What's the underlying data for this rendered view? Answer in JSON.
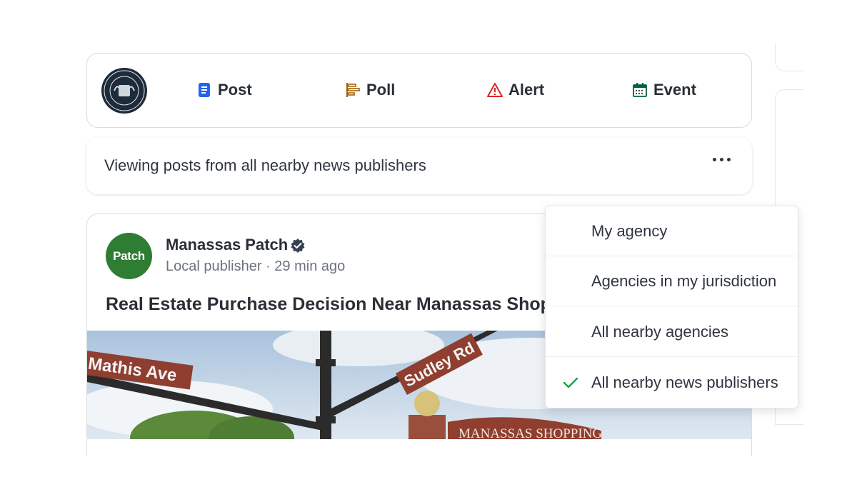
{
  "composer": {
    "agency_seal_icon": "county-seal-icon",
    "actions": [
      {
        "label": "Post",
        "icon": "post-icon",
        "color": "#2563eb"
      },
      {
        "label": "Poll",
        "icon": "poll-icon",
        "color": "#a16207"
      },
      {
        "label": "Alert",
        "icon": "alert-icon",
        "color": "#dc2626"
      },
      {
        "label": "Event",
        "icon": "calendar-icon",
        "color": "#065f46"
      }
    ]
  },
  "filter": {
    "text": "Viewing posts from all nearby news publishers",
    "more_icon": "more-horizontal-icon"
  },
  "post": {
    "avatar_text": "Patch",
    "avatar_color": "#2e7d32",
    "publisher": "Manassas Patch",
    "verified_icon": "verified-badge-icon",
    "meta": "Local publisher · 29 min ago",
    "title": "Real Estate Purchase Decision Near Manassas Shopping",
    "image": {
      "signs": [
        "Mathis Ave",
        "Sudley Rd",
        "MANASSAS SHOPPING"
      ]
    }
  },
  "menu": {
    "items": [
      {
        "label": "My agency",
        "selected": false
      },
      {
        "label": "Agencies in my jurisdiction",
        "selected": false
      },
      {
        "label": "All nearby agencies",
        "selected": false
      },
      {
        "label": "All nearby news publishers",
        "selected": true
      }
    ],
    "check_color": "#16a34a"
  }
}
